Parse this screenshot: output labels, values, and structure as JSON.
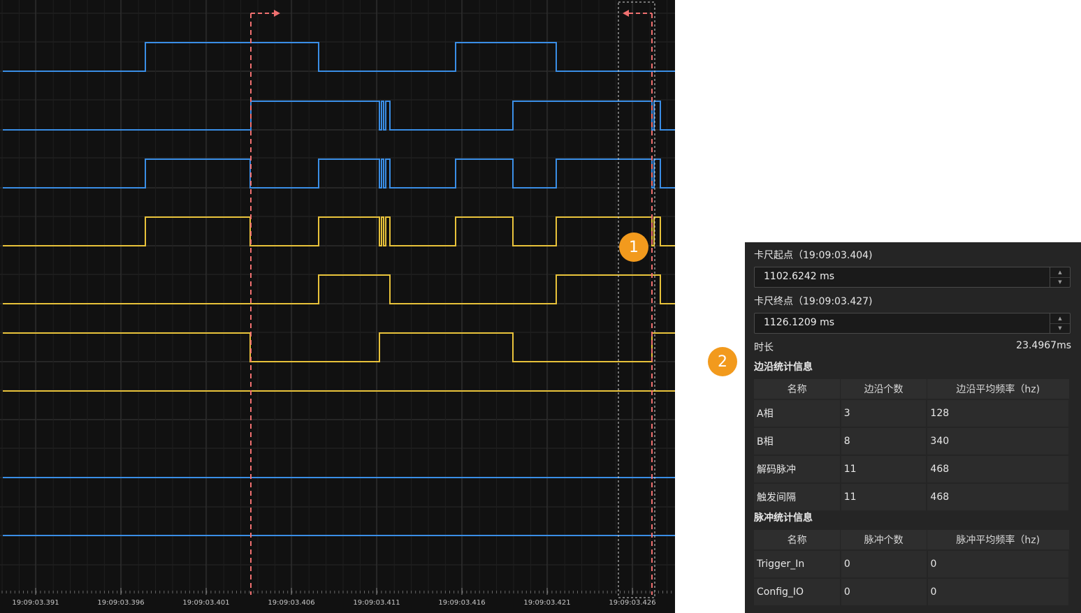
{
  "timeline": {
    "tick_labels": [
      "19:09:03.391",
      "19:09:03.396",
      "19:09:03.401",
      "19:09:03.406",
      "19:09:03.411",
      "19:09:03.416",
      "19:09:03.421",
      "19:09:03.426"
    ],
    "colors": {
      "background": "#111111",
      "blue": "#3a8ee6",
      "yellow": "#e8c23a",
      "cursor": "#f07070",
      "grid": "#3a3a3a"
    }
  },
  "annotations": {
    "badge1": "1",
    "badge2": "2"
  },
  "caliper": {
    "start_label": "卡尺起点（19:09:03.404)",
    "start_value": "1102.6242 ms",
    "end_label": "卡尺终点（19:09:03.427)",
    "end_value": "1126.1209 ms",
    "duration_label": "时长",
    "duration_value": "23.4967ms"
  },
  "edge_stats": {
    "title": "边沿统计信息",
    "headers": [
      "名称",
      "边沿个数",
      "边沿平均频率（hz)"
    ],
    "rows": [
      [
        "A相",
        "3",
        "128"
      ],
      [
        "B相",
        "8",
        "340"
      ],
      [
        "解码脉冲",
        "11",
        "468"
      ],
      [
        "触发间隔",
        "11",
        "468"
      ]
    ]
  },
  "pulse_stats": {
    "title": "脉冲统计信息",
    "headers": [
      "名称",
      "脉冲个数",
      "脉冲平均频率（hz)"
    ],
    "rows": [
      [
        "Trigger_In",
        "0",
        "0"
      ],
      [
        "Config_IO",
        "0",
        "0"
      ]
    ]
  }
}
